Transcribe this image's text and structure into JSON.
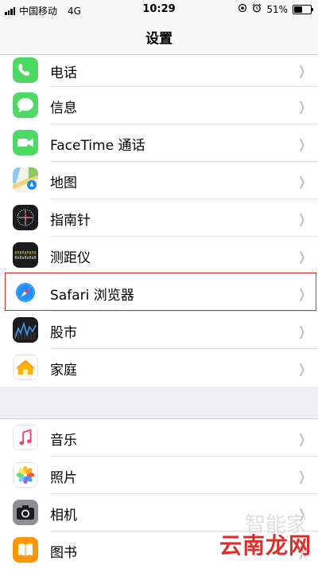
{
  "status_bar": {
    "carrier": "中国移动",
    "network": "4G",
    "time": "10:29",
    "battery": "51%",
    "battery_level": 0.51
  },
  "nav": {
    "title": "设置"
  },
  "group1": [
    {
      "label": "电话",
      "icon": "phone-icon",
      "color": "#4cd964"
    },
    {
      "label": "信息",
      "icon": "messages-icon",
      "color": "#4cd964"
    },
    {
      "label": "FaceTime 通话",
      "icon": "facetime-icon",
      "color": "#4cd964"
    },
    {
      "label": "地图",
      "icon": "maps-icon",
      "color": "#7cc36a"
    },
    {
      "label": "指南针",
      "icon": "compass-icon",
      "color": "#1c1c1e"
    },
    {
      "label": "测距仪",
      "icon": "measure-icon",
      "color": "#1c1c1e"
    },
    {
      "label": "Safari 浏览器",
      "icon": "safari-icon",
      "color": "#1e90ff"
    },
    {
      "label": "股市",
      "icon": "stocks-icon",
      "color": "#1c1c1e"
    },
    {
      "label": "家庭",
      "icon": "home-icon",
      "color": "#ffffff"
    }
  ],
  "group2": [
    {
      "label": "音乐",
      "icon": "music-icon",
      "color": "#ffffff"
    },
    {
      "label": "照片",
      "icon": "photos-icon",
      "color": "#ffffff"
    },
    {
      "label": "相机",
      "icon": "camera-icon",
      "color": "#8e8e93"
    },
    {
      "label": "图书",
      "icon": "books-icon",
      "color": "#ff9500"
    }
  ],
  "watermark": {
    "text": "云南龙网",
    "ghost": "智能家"
  },
  "highlight_color": "#d9302c"
}
